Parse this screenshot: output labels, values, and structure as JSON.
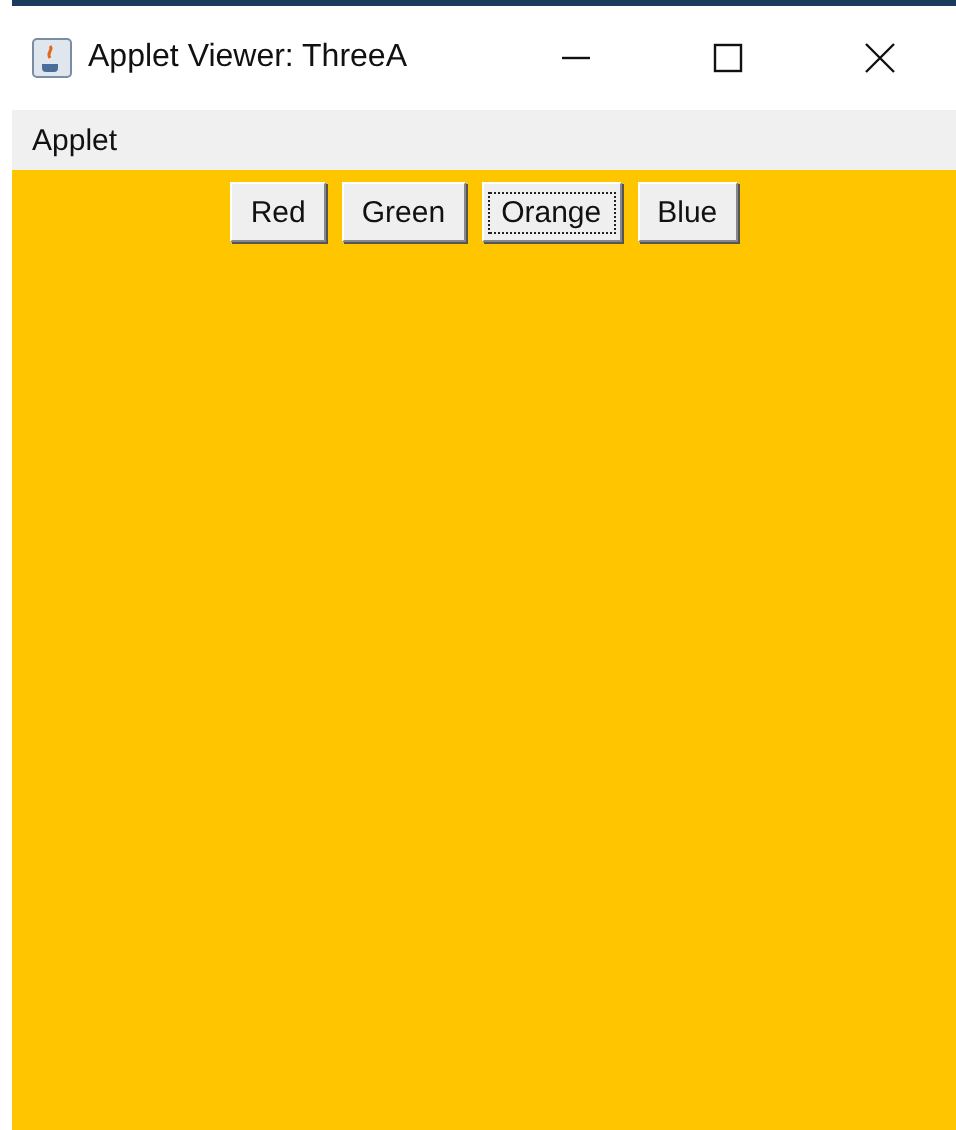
{
  "window": {
    "title": "Applet Viewer: ThreeA"
  },
  "menu_bar": [
    "Applet"
  ],
  "buttons": [
    {
      "label": "Red",
      "focused": false
    },
    {
      "label": "Green",
      "focused": false
    },
    {
      "label": "Orange",
      "focused": true
    },
    {
      "label": "Blue",
      "focused": false
    }
  ]
}
